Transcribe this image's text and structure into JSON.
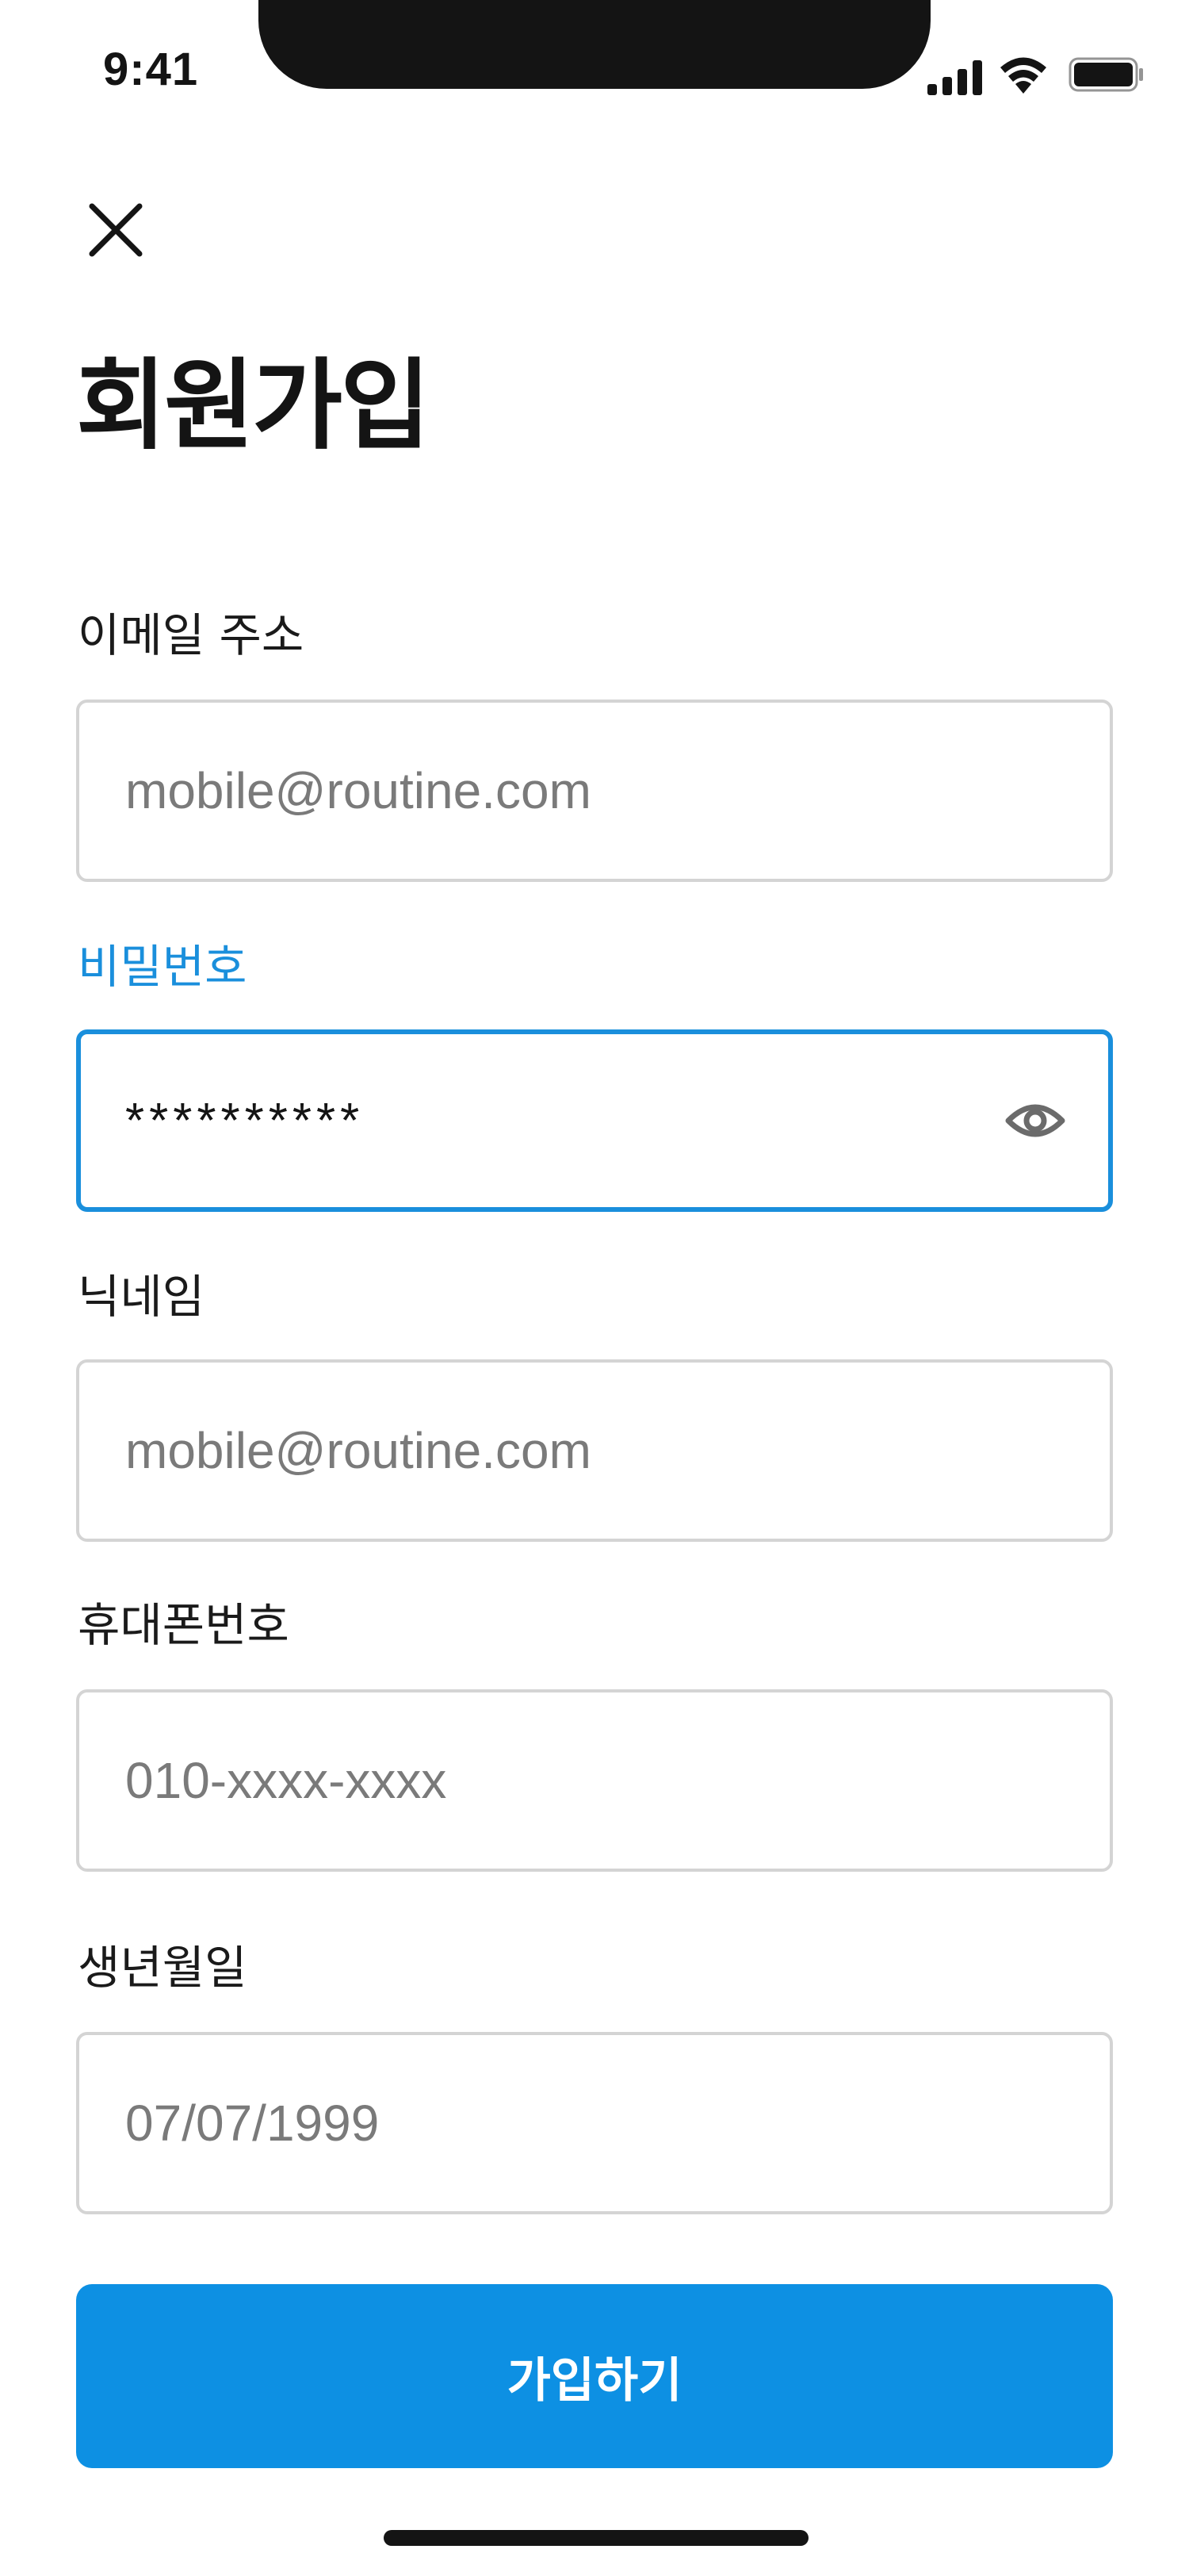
{
  "status_bar": {
    "time": "9:41"
  },
  "header": {
    "close_icon": "close-icon",
    "title": "회원가입"
  },
  "form": {
    "email": {
      "label": "이메일 주소",
      "value": "",
      "placeholder": "mobile@routine.com"
    },
    "password": {
      "label": "비밀번호",
      "value": "**********",
      "placeholder": "",
      "toggle_icon": "eye-icon"
    },
    "nickname": {
      "label": "닉네임",
      "value": "",
      "placeholder": "mobile@routine.com"
    },
    "phone": {
      "label": "휴대폰번호",
      "value": "",
      "placeholder": "010-xxxx-xxxx"
    },
    "birthdate": {
      "label": "생년월일",
      "value": "",
      "placeholder": "07/07/1999"
    }
  },
  "submit": {
    "label": "가입하기"
  },
  "colors": {
    "accent": "#0d90e3",
    "focus_border": "#1a8fdc",
    "input_border": "#d4d4d4",
    "placeholder": "#7a7a7a",
    "text": "#141414"
  }
}
